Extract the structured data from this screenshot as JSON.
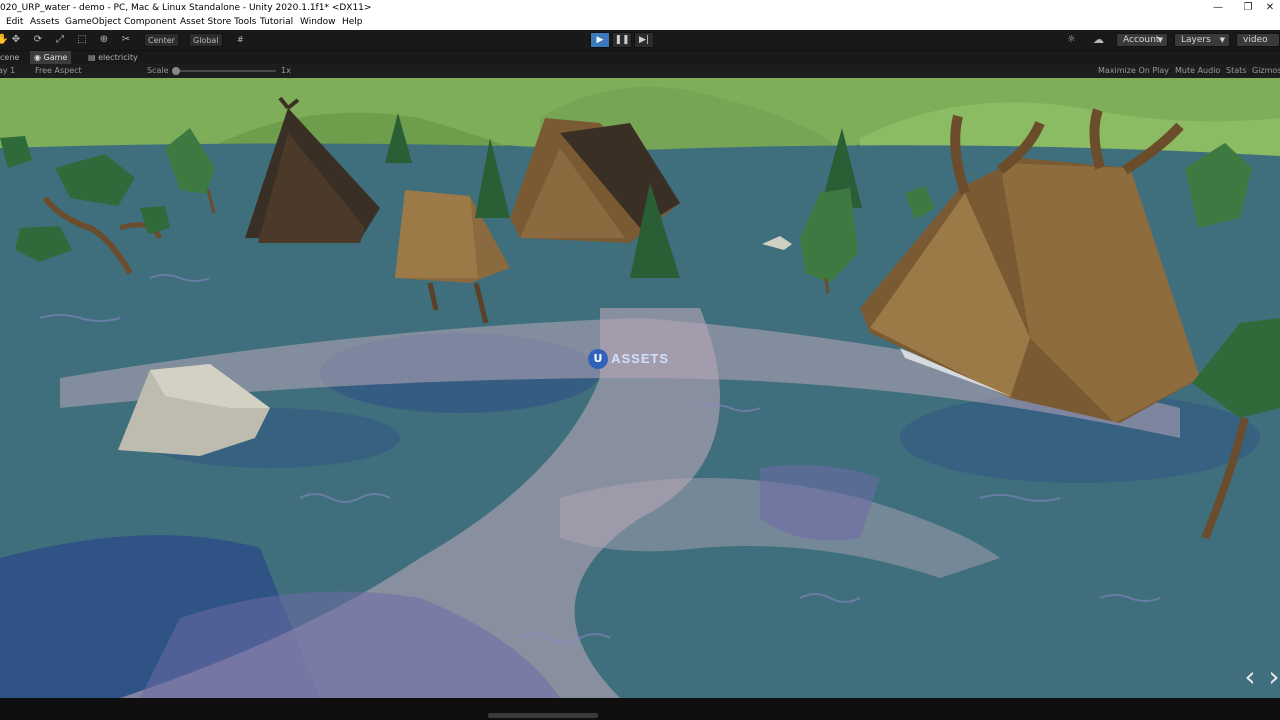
{
  "window": {
    "title": "020_URP_water - demo - PC, Mac & Linux Standalone - Unity 2020.1.1f1* <DX11>",
    "minimize": "—",
    "maximize": "❐",
    "close": "✕"
  },
  "menu": [
    "Edit",
    "Assets",
    "GameObject",
    "Component",
    "Asset Store Tools",
    "Tutorial",
    "Window",
    "Help"
  ],
  "toolbar": {
    "tools": [
      {
        "icon": "hand-tool-icon",
        "glyph": "✋"
      },
      {
        "icon": "move-tool-icon",
        "glyph": "✥"
      },
      {
        "icon": "rotate-tool-icon",
        "glyph": "⟳"
      },
      {
        "icon": "scale-tool-icon",
        "glyph": "⤢"
      },
      {
        "icon": "rect-tool-icon",
        "glyph": "⬚"
      },
      {
        "icon": "transform-tool-icon",
        "glyph": "⊕"
      },
      {
        "icon": "custom-tool-icon",
        "glyph": "✂"
      }
    ],
    "pivot": "Center",
    "space": "Global",
    "snap_glyph": "#",
    "play_glyph": "▶",
    "pause_glyph": "❚❚",
    "step_glyph": "▶|",
    "collab_glyph": "☼",
    "cloud_glyph": "☁",
    "account": "Account",
    "layers": "Layers",
    "layout": "video",
    "caret": "▼"
  },
  "tabs": [
    {
      "label": "cene",
      "active": false
    },
    {
      "label": "Game",
      "active": true,
      "icon": "game-icon",
      "glyph": "◉"
    },
    {
      "label": "electricity",
      "active": false,
      "icon": "animation-icon",
      "glyph": "▤"
    }
  ],
  "game_toolbar": {
    "display": "ay 1",
    "aspect": "Free Aspect",
    "scale_label": "Scale",
    "scale_value": "1x",
    "scale_fraction": 0.0,
    "maximize_on_play": "Maximize On Play",
    "mute_audio": "Mute Audio",
    "stats": "Stats",
    "gizmos": "Gizmos"
  },
  "viewport": {
    "logo_letter": "U",
    "logo_text": "ASSETS",
    "nav_prev": "‹",
    "nav_next": "›",
    "colors": {
      "water": "#3f6f7c",
      "water_deep": "#2d4f86",
      "foam_path": "#b9a6b8",
      "ripple": "#6d6aa8",
      "hills": "#7fae5a",
      "wood": "#7a5a33",
      "roof_dark": "#3a2f24",
      "tree": "#2f6a3a",
      "rock": "#bdbcae"
    }
  }
}
